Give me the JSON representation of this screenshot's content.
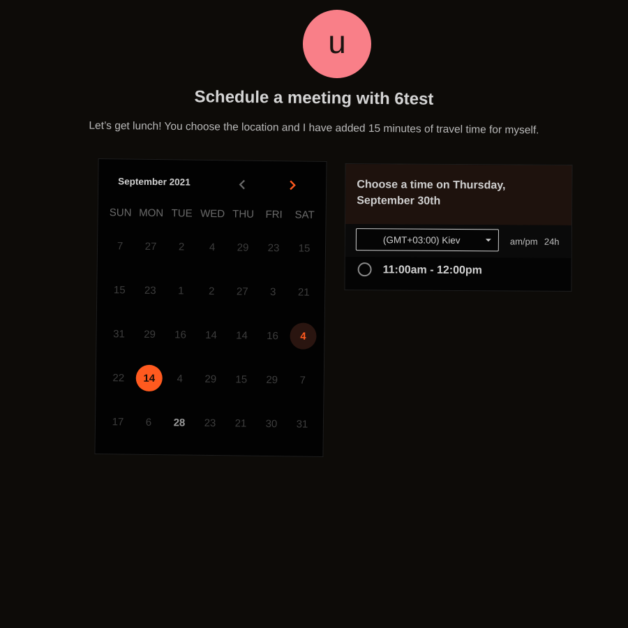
{
  "profile": {
    "avatar_initial": "u"
  },
  "header": {
    "title": "Schedule a meeting with 6test",
    "subtitle": "Let’s get lunch! You choose the location and I have added 15 minutes of travel time for myself."
  },
  "calendar": {
    "month_label": "September 2021",
    "prev_icon": "chevron-left-icon",
    "next_icon": "chevron-right-icon",
    "weekdays": [
      "SUN",
      "MON",
      "TUE",
      "WED",
      "THU",
      "FRI",
      "SAT"
    ],
    "days": [
      "7",
      "27",
      "2",
      "4",
      "29",
      "23",
      "15",
      "15",
      "23",
      "1",
      "2",
      "27",
      "3",
      "21",
      "31",
      "29",
      "16",
      "14",
      "14",
      "16",
      "4",
      "22",
      "14",
      "4",
      "29",
      "15",
      "29",
      "7",
      "17",
      "6",
      "28",
      "23",
      "21",
      "30",
      "31"
    ],
    "available_day": "4",
    "selected_day": "14",
    "emphasized_day": "28"
  },
  "time_panel": {
    "heading_line1": "Choose a time on Thursday,",
    "heading_line2": "September 30th",
    "timezone": "(GMT+03:00) Kiev",
    "format_ampm": "am/pm",
    "format_24h": "24h",
    "slots": [
      {
        "label": "11:00am - 12:00pm"
      }
    ]
  },
  "colors": {
    "background": "#0d0b08",
    "accent": "#ff5a1f",
    "avatar": "#f97f88",
    "panel_header": "#1e120d"
  }
}
